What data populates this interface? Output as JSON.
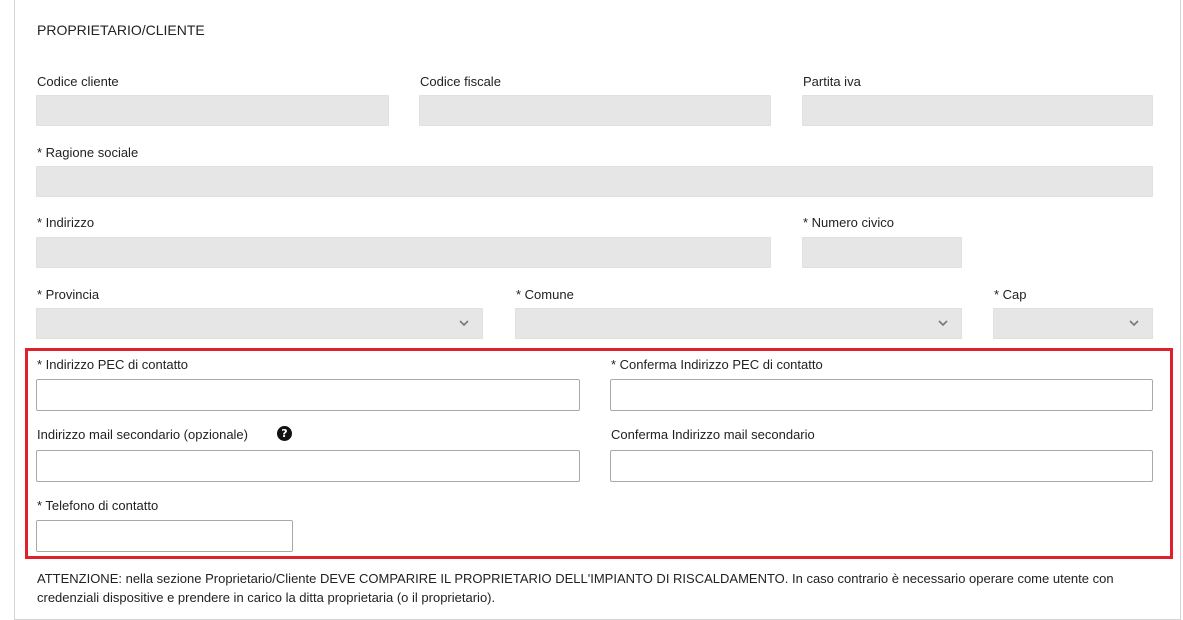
{
  "section": {
    "title": "PROPRIETARIO/CLIENTE"
  },
  "fields": {
    "codice_cliente": {
      "label": "Codice cliente",
      "value": ""
    },
    "codice_fiscale": {
      "label": "Codice fiscale",
      "value": ""
    },
    "partita_iva": {
      "label": "Partita iva",
      "value": ""
    },
    "ragione_sociale": {
      "label": "* Ragione sociale",
      "value": ""
    },
    "indirizzo": {
      "label": "* Indirizzo",
      "value": ""
    },
    "numero_civico": {
      "label": "* Numero civico",
      "value": ""
    },
    "provincia": {
      "label": "* Provincia",
      "value": ""
    },
    "comune": {
      "label": "* Comune",
      "value": ""
    },
    "cap": {
      "label": "* Cap",
      "value": ""
    }
  },
  "contact": {
    "pec": {
      "label": "* Indirizzo PEC di contatto",
      "value": ""
    },
    "pec_confirm": {
      "label": "* Conferma Indirizzo PEC di contatto",
      "value": ""
    },
    "mail_secondary": {
      "label": "Indirizzo mail secondario (opzionale)",
      "value": ""
    },
    "mail_secondary_confirm": {
      "label": "Conferma Indirizzo mail secondario",
      "value": ""
    },
    "phone": {
      "label": "* Telefono di contatto",
      "value": ""
    }
  },
  "notice": {
    "text": "ATTENZIONE: nella sezione Proprietario/Cliente DEVE COMPARIRE IL PROPRIETARIO DELL'IMPIANTO DI RISCALDAMENTO. In caso contrario è necessario operare come utente con credenziali dispositive e prendere in carico la ditta proprietaria (o il proprietario)."
  },
  "colors": {
    "highlight_border": "#e0202a",
    "readonly_bg": "#e6e6e6",
    "input_border": "#a9a9a9"
  },
  "icons": {
    "help": "question-circle-icon",
    "dropdown": "chevron-down-icon"
  }
}
